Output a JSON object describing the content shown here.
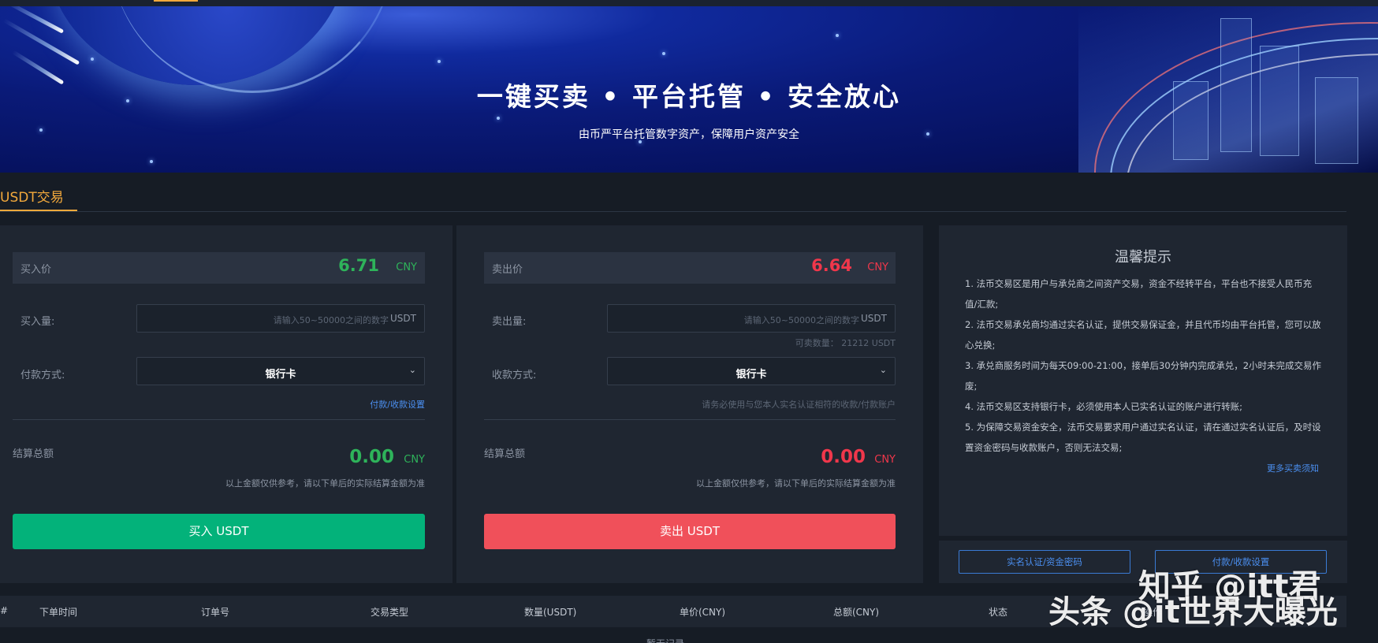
{
  "banner": {
    "title": "一键买卖 • 平台托管 • 安全放心",
    "subtitle": "由币严平台托管数字资产，保障用户资产安全"
  },
  "section_tab": "USDT交易",
  "buy": {
    "price_label": "买入价",
    "price_value": "6.71",
    "price_unit": "CNY",
    "amount_label": "买入量:",
    "amount_placeholder": "请输入50~50000之间的数字",
    "amount_suffix": "USDT",
    "payment_label": "付款方式:",
    "payment_value": "银行卡",
    "settings_link": "付款/收款设置",
    "total_label": "结算总额",
    "total_value": "0.00",
    "total_unit": "CNY",
    "total_note": "以上金额仅供参考，请以下单后的实际结算金额为准",
    "button": "买入 USDT"
  },
  "sell": {
    "price_label": "卖出价",
    "price_value": "6.64",
    "price_unit": "CNY",
    "amount_label": "卖出量:",
    "amount_placeholder": "请输入50~50000之间的数字",
    "amount_suffix": "USDT",
    "available": "可卖数量： 21212 USDT",
    "receive_label": "收款方式:",
    "receive_value": "银行卡",
    "receive_hint": "请务必使用与您本人实名认证相符的收款/付款账户",
    "total_label": "结算总额",
    "total_value": "0.00",
    "total_unit": "CNY",
    "total_note": "以上金额仅供参考，请以下单后的实际结算金额为准",
    "button": "卖出 USDT"
  },
  "tips": {
    "title": "温馨提示",
    "items": [
      "1. 法币交易区是用户与承兑商之间资产交易，资金不经转平台，平台也不接受人民币充值/汇款;",
      "2. 法币交易承兑商均通过实名认证，提供交易保证金，并且代币均由平台托管，您可以放心兑换;",
      "3. 承兑商服务时间为每天09:00-21:00，接单后30分钟内完成承兑，2小时未完成交易作废;",
      "4. 法币交易区支持银行卡，必须使用本人已实名认证的账户进行转账;",
      "5. 为保障交易资金安全，法币交易要求用户通过实名认证，请在通过实名认证后，及时设置资金密码与收款账户，否则无法交易;"
    ],
    "more_link": "更多买卖须知",
    "btn_verify": "实名认证/资金密码",
    "btn_payment": "付款/收款设置"
  },
  "table": {
    "columns": [
      "#",
      "下单时间",
      "订单号",
      "交易类型",
      "数量(USDT)",
      "单价(CNY)",
      "总额(CNY)",
      "状态",
      "操作"
    ],
    "empty_text": "暂无记录"
  },
  "watermark": {
    "line1": "知乎 @itt君",
    "line2": "头条 @it世界大曝光"
  },
  "colors": {
    "accent": "#f3a93c",
    "buy_green": "#03b27a",
    "sell_red": "#f0505a",
    "price_green": "#2eb35a",
    "price_red": "#f0374b",
    "link_blue": "#4b8ff0"
  }
}
